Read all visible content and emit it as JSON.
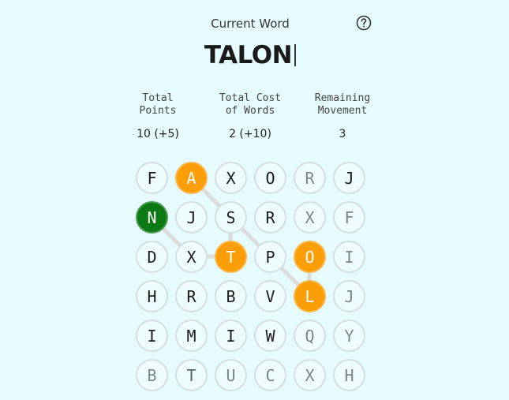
{
  "header": {
    "current_word_label": "Current Word",
    "current_word": "TALON",
    "help_icon": "question-circle-icon"
  },
  "stats": [
    {
      "label": "Total\nPoints",
      "value": "10 (+5)"
    },
    {
      "label": "Total Cost\nof Words",
      "value": "2 (+10)"
    },
    {
      "label": "Remaining\nMovement",
      "value": "3"
    }
  ],
  "colors": {
    "background": "#e6fbfd",
    "selected_tile": "#fb9e07",
    "start_tile": "#0c7a14",
    "tile_border": "#d4dfe2",
    "path": "#dcdcdc"
  },
  "board": {
    "rows": [
      [
        "F",
        "A",
        "X",
        "O",
        "R",
        "J"
      ],
      [
        "N",
        "J",
        "S",
        "R",
        "X",
        "F"
      ],
      [
        "D",
        "X",
        "T",
        "P",
        "O",
        "I"
      ],
      [
        "H",
        "R",
        "B",
        "V",
        "L",
        "J"
      ],
      [
        "I",
        "M",
        "I",
        "W",
        "Q",
        "Y"
      ],
      [
        "B",
        "T",
        "U",
        "C",
        "X",
        "H"
      ]
    ],
    "selected": [
      [
        0,
        1
      ],
      [
        2,
        2
      ],
      [
        2,
        4
      ],
      [
        3,
        4
      ]
    ],
    "start": [
      [
        1,
        0
      ]
    ],
    "path": [
      [
        1,
        0
      ],
      [
        2,
        1
      ],
      [
        2,
        2
      ],
      [
        1,
        2
      ],
      [
        0,
        1
      ],
      [
        1,
        2
      ],
      [
        2,
        3
      ],
      [
        3,
        4
      ],
      [
        2,
        4
      ]
    ]
  }
}
